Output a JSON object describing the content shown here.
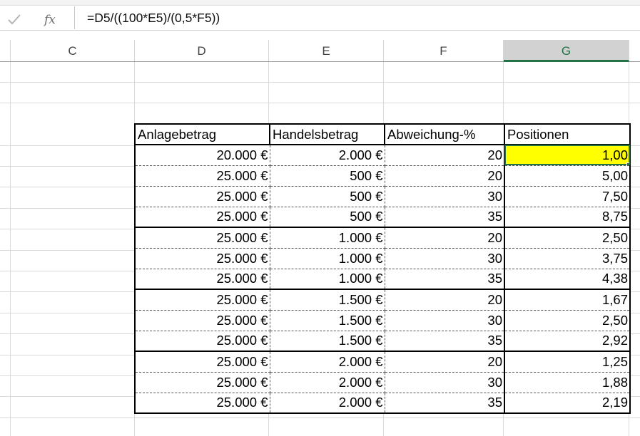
{
  "formula_bar": {
    "formula": "=D5/((100*E5)/(0,5*F5))",
    "enter_icon": "check-icon",
    "function_icon": "fx-icon",
    "function_label": "fx"
  },
  "columns": [
    {
      "label": "C",
      "selected": false
    },
    {
      "label": "D",
      "selected": false
    },
    {
      "label": "E",
      "selected": false
    },
    {
      "label": "F",
      "selected": false
    },
    {
      "label": "G",
      "selected": true
    }
  ],
  "selection_color": "#217346",
  "highlight_color": "#ffff00",
  "table": {
    "headers": [
      "Anlagebetrag",
      "Handelsbetrag",
      "Abweichung-%",
      "Positionen"
    ],
    "rows": [
      [
        "20.000 €",
        "2.000 €",
        "20",
        "1,00"
      ],
      [
        "25.000 €",
        "500 €",
        "20",
        "5,00"
      ],
      [
        "25.000 €",
        "500 €",
        "30",
        "7,50"
      ],
      [
        "25.000 €",
        "500 €",
        "35",
        "8,75"
      ],
      [
        "25.000 €",
        "1.000 €",
        "20",
        "2,50"
      ],
      [
        "25.000 €",
        "1.000 €",
        "30",
        "3,75"
      ],
      [
        "25.000 €",
        "1.000 €",
        "35",
        "4,38"
      ],
      [
        "25.000 €",
        "1.500 €",
        "20",
        "1,67"
      ],
      [
        "25.000 €",
        "1.500 €",
        "30",
        "2,50"
      ],
      [
        "25.000 €",
        "1.500 €",
        "35",
        "2,92"
      ],
      [
        "25.000 €",
        "2.000 €",
        "20",
        "1,25"
      ],
      [
        "25.000 €",
        "2.000 €",
        "30",
        "1,88"
      ],
      [
        "25.000 €",
        "2.000 €",
        "35",
        "2,19"
      ]
    ]
  }
}
